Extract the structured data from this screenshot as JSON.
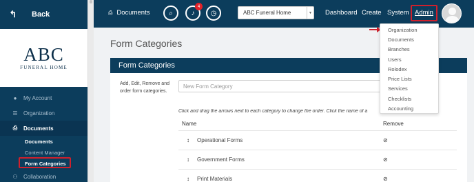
{
  "sidebar": {
    "back_label": "Back",
    "logo_text": "ABC",
    "logo_sub": "FUNERAL HOME",
    "nav": [
      {
        "label": "My Account",
        "icon": "user-icon"
      },
      {
        "label": "Organization",
        "icon": "list-icon"
      },
      {
        "label": "Documents",
        "icon": "print-icon"
      },
      {
        "label": "Collaboration",
        "icon": "users-icon"
      }
    ],
    "sub": [
      {
        "label": "Documents"
      },
      {
        "label": "Content Manager"
      },
      {
        "label": "Form Categories"
      }
    ]
  },
  "header": {
    "section": "Documents",
    "notification_count": "4",
    "org_selected": "ABC Funeral Home",
    "links": {
      "dashboard": "Dashboard",
      "create": "Create",
      "system": "System",
      "admin": "Admin"
    }
  },
  "main": {
    "page_title": "Form Categories",
    "panel_title": "Form Categories",
    "help_text": "Add, Edit, Remove and order form categories.",
    "new_category_placeholder": "New Form Category",
    "instructions": "Click and drag the arrows next to each category to change the order. Click the name of a",
    "table": {
      "headers": {
        "name": "Name",
        "remove": "Remove"
      },
      "rows": [
        {
          "name": "Operational Forms"
        },
        {
          "name": "Government Forms"
        },
        {
          "name": "Print Materials"
        }
      ]
    }
  },
  "admin_menu": {
    "items": [
      "Organization",
      "Documents",
      "Branches",
      "Users",
      "Rolodex",
      "Price Lists",
      "Services",
      "Checklists",
      "Accounting"
    ]
  },
  "colors": {
    "primary": "#0c3d5c",
    "highlight": "#d0202c",
    "badge": "#e1222a"
  }
}
